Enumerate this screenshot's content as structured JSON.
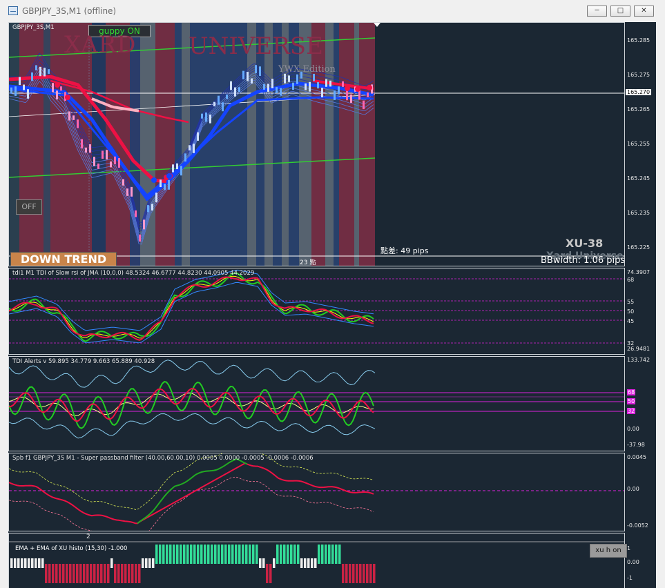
{
  "window": {
    "title": "GBPJPY_3S,M1 (offline)"
  },
  "main_chart": {
    "symbol_label": "GBPJPY_3S,M1",
    "guppy_button": "guppy ON",
    "brand_xard": "XARD",
    "brand_universe": "UNIVERSE",
    "edition_text": "YWX Edition",
    "off_button": "OFF",
    "trend_label": "DOWN TREND",
    "spread_text": "點差: 49 pips",
    "bar_count_text": "23 點",
    "xu_label": "XU-38",
    "xard_universe_label": "Xard Universe",
    "bbwidth_text": "BBwidth: 1.06 pips",
    "price_axis": [
      "165.285",
      "165.275",
      "165.265",
      "165.255",
      "165.245",
      "165.235",
      "165.225"
    ],
    "current_price": "165.270"
  },
  "tdi1": {
    "title": "tdi1 M1 TDI of Slow rsi of JMA (10,0,0) 48.5324 46.6777 44.8230 44.0905 44.2029",
    "axis": [
      "74.3907",
      "68",
      "55",
      "50",
      "45",
      "32",
      "26.9481"
    ]
  },
  "tdi_alerts": {
    "title": "TDI Alerts v 59.895 34.779 9.663 65.889 40.928",
    "axis": [
      "133.742",
      "0.00",
      "-37.98"
    ],
    "levels": [
      "68",
      "50",
      "32"
    ]
  },
  "spb": {
    "title": "Spb f1 GBPJPY_3S M1 - Super passband filter (40.00,60.00,10) 0.0005 0.0000 -0.0005 -0.0006 -0.0006",
    "axis": [
      "0.0045",
      "0.00",
      "-0.0052"
    ]
  },
  "ema_histo": {
    "title": "EMA + EMA of  XU histo (15,30) -1.000",
    "marker": "2",
    "axis": [
      "1",
      "0.00",
      "-1"
    ],
    "button": "xu h on"
  },
  "colors": {
    "bg": "#1b2733",
    "bull": "#1444ff",
    "bear": "#ee1144",
    "green": "#22cc22",
    "magenta": "#dd22dd",
    "histo_up": "#33dd99",
    "histo_down": "#cc2244"
  }
}
